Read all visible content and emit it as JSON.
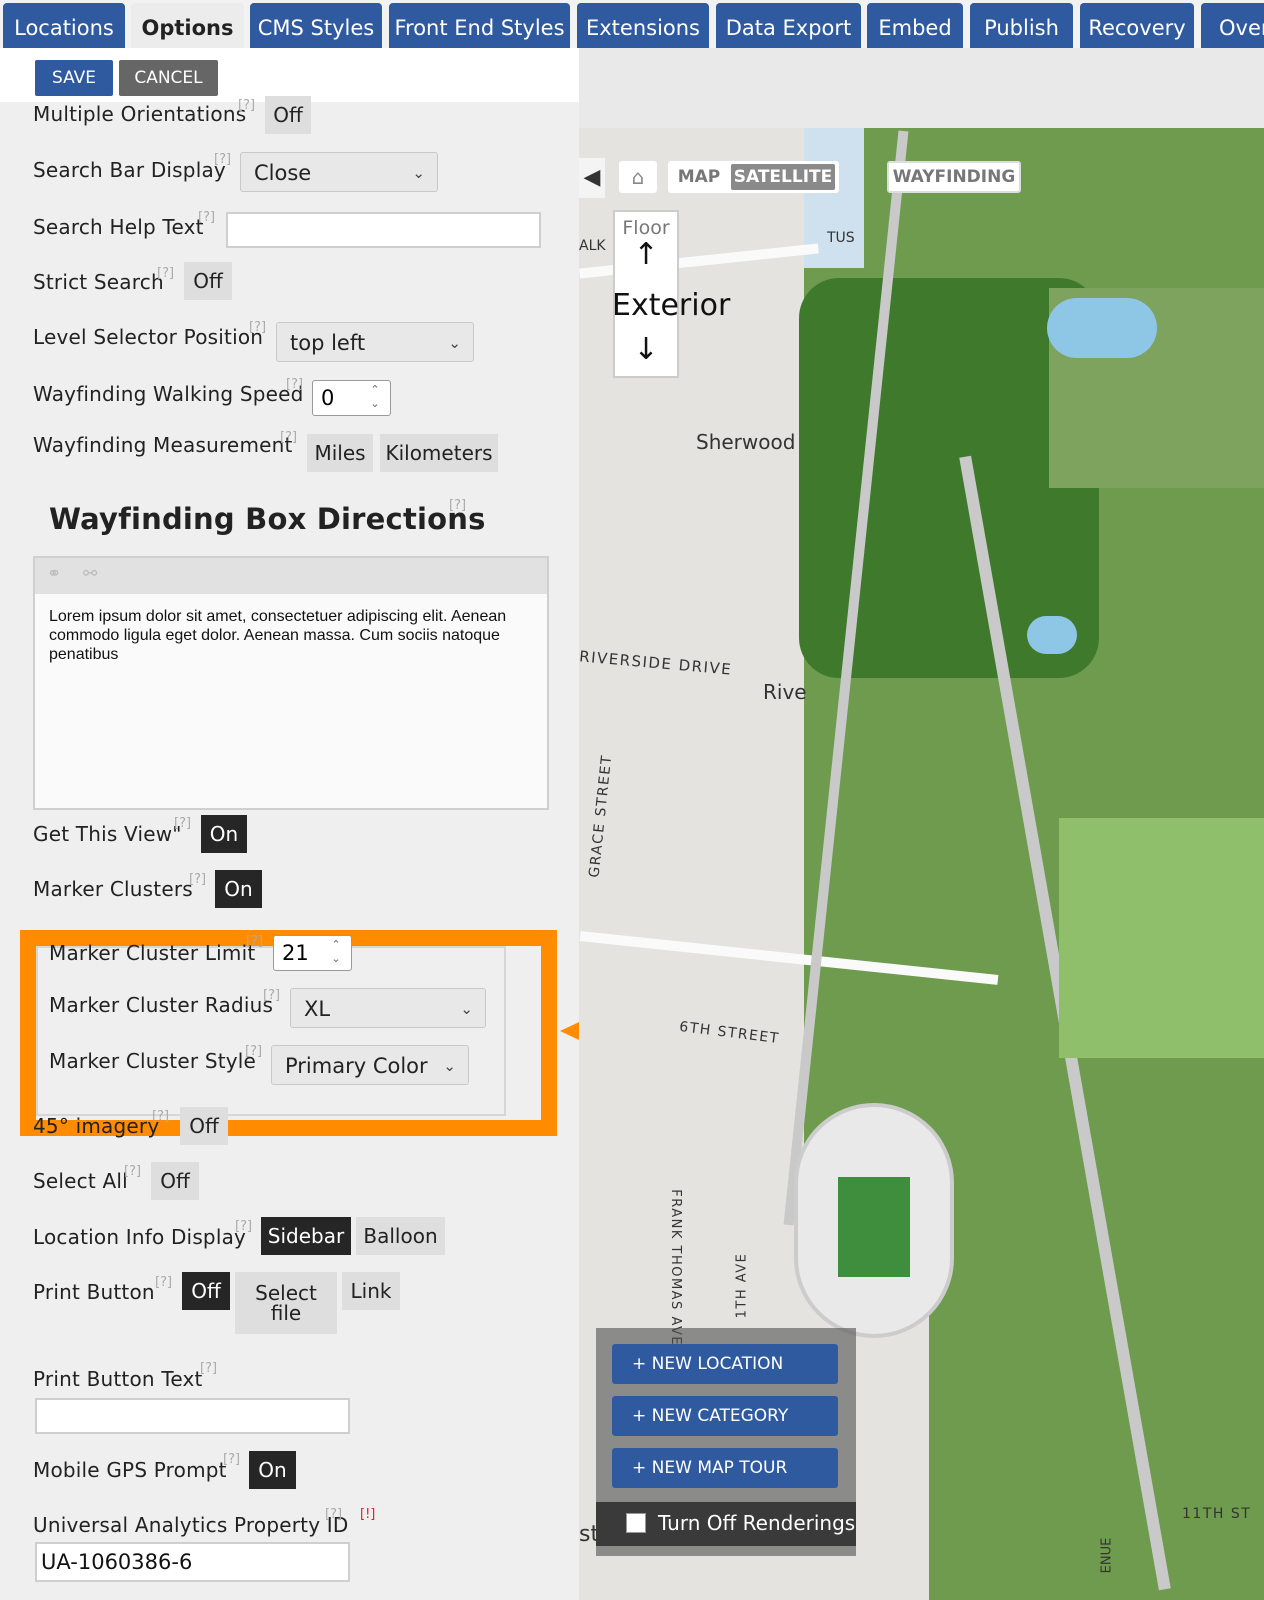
{
  "tabs": [
    {
      "label": "Locations",
      "active": false
    },
    {
      "label": "Options",
      "active": true
    },
    {
      "label": "CMS Styles",
      "active": false
    },
    {
      "label": "Front End Styles",
      "active": false
    },
    {
      "label": "Extensions",
      "active": false
    },
    {
      "label": "Data Export",
      "active": false
    },
    {
      "label": "Embed",
      "active": false
    },
    {
      "label": "Publish",
      "active": false
    },
    {
      "label": "Recovery",
      "active": false
    },
    {
      "label": "Over",
      "active": false
    }
  ],
  "toolbar": {
    "save_label": "SAVE",
    "cancel_label": "CANCEL"
  },
  "help_marker": "[?]",
  "error_marker": "[!]",
  "options": {
    "multiple_orientations": {
      "label": "Multiple Orientations",
      "value": "Off"
    },
    "search_bar_display": {
      "label": "Search Bar Display",
      "value": "Close"
    },
    "search_help_text": {
      "label": "Search Help Text",
      "value": ""
    },
    "strict_search": {
      "label": "Strict Search",
      "value": "Off"
    },
    "level_selector_position": {
      "label": "Level Selector Position",
      "value": "top left"
    },
    "walking_speed": {
      "label": "Wayfinding Walking Speed",
      "value": "0"
    },
    "measurement": {
      "label": "Wayfinding Measurement",
      "opt1": "Miles",
      "opt2": "Kilometers"
    },
    "box_directions": {
      "heading": "Wayfinding Box Directions",
      "text": "Lorem ipsum dolor sit amet, consectetuer adipiscing elit. Aenean commodo ligula eget dolor. Aenean massa. Cum sociis natoque penatibus"
    },
    "get_this_view": {
      "label": "Get This View\"",
      "value": "On"
    },
    "marker_clusters": {
      "label": "Marker Clusters",
      "value": "On"
    },
    "marker_cluster_limit": {
      "label": "Marker Cluster Limit",
      "value": "21"
    },
    "marker_cluster_radius": {
      "label": "Marker Cluster Radius",
      "value": "XL"
    },
    "marker_cluster_style": {
      "label": "Marker Cluster Style",
      "value": "Primary Color"
    },
    "imagery_45": {
      "label": "45° imagery",
      "value": "Off"
    },
    "select_all": {
      "label": "Select All",
      "value": "Off"
    },
    "location_info_display": {
      "label": "Location Info Display",
      "opt1": "Sidebar",
      "opt2": "Balloon"
    },
    "print_button": {
      "label": "Print Button",
      "opt1": "Off",
      "opt2_line1": "Select",
      "opt2_line2": "file",
      "opt3": "Link"
    },
    "print_button_text": {
      "label": "Print Button Text",
      "value": ""
    },
    "mobile_gps_prompt": {
      "label": "Mobile GPS Prompt",
      "value": "On"
    },
    "analytics_id": {
      "label": "Universal Analytics Property ID",
      "value": "UA-1060386-6"
    }
  },
  "map": {
    "map_tab": "MAP",
    "satellite_tab": "SATELLITE",
    "wayfinding": "WAYFINDING",
    "floor_label": "Floor",
    "floor_value": "Exterior",
    "up_arrow": "↑",
    "down_arrow": "↓",
    "labels": {
      "sherwood": "Sherwood",
      "riverside": "RIVERSIDE DRIVE",
      "rive": "Rive",
      "grace": "GRACE STREET",
      "sixth": "6TH STREET",
      "frank": "FRANK THOMAS AVE.",
      "eleventh": "11TH ST",
      "stend": "st End",
      "tus": "TUS",
      "alk": "ALK",
      "enue": "ENUE",
      "ave": "1TH AVE"
    },
    "buttons": {
      "new_location": "+ NEW LOCATION",
      "new_category": "+ NEW CATEGORY",
      "new_tour": "+ NEW MAP TOUR"
    },
    "renderings_label": "Turn Off Renderings"
  },
  "colors": {
    "tab_blue": "#2f5aa0",
    "highlight": "#ff8c00",
    "toggle_on": "#262626",
    "toggle_off": "#dedede"
  }
}
